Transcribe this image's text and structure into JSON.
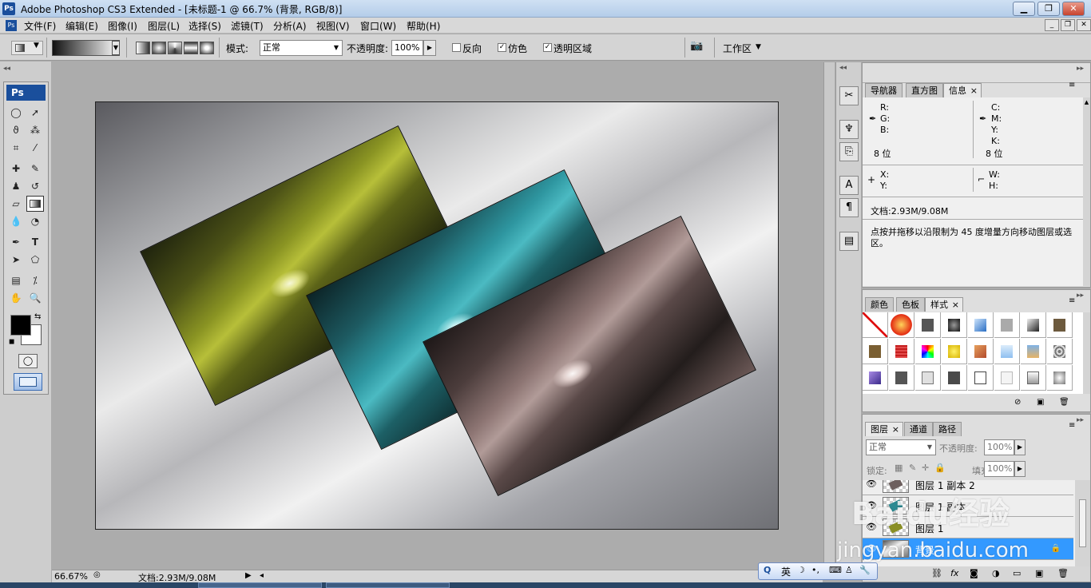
{
  "window": {
    "title": "Adobe Photoshop CS3 Extended - [未标题-1 @ 66.7% (背景, RGB/8)]",
    "logo": "Ps"
  },
  "menu": [
    "文件(F)",
    "编辑(E)",
    "图像(I)",
    "图层(L)",
    "选择(S)",
    "滤镜(T)",
    "分析(A)",
    "视图(V)",
    "窗口(W)",
    "帮助(H)"
  ],
  "options": {
    "mode_label": "模式:",
    "mode_value": "正常",
    "opacity_label": "不透明度:",
    "opacity_value": "100%",
    "reverse_label": "反向",
    "dither_label": "仿色",
    "transparency_label": "透明区域",
    "workspace_label": "工作区"
  },
  "toolbox": {
    "logo": "Ps"
  },
  "status": {
    "zoom": "66.67%",
    "doc": "文档:2.93M/9.08M"
  },
  "info_panel": {
    "tabs": [
      "导航器",
      "直方图",
      "信息"
    ],
    "rgb": [
      "R:",
      "G:",
      "B:"
    ],
    "cmyk": [
      "C:",
      "M:",
      "Y:",
      "K:"
    ],
    "bits_left": "8 位",
    "bits_right": "8 位",
    "xy": [
      "X:",
      "Y:"
    ],
    "wh": [
      "W:",
      "H:"
    ],
    "doc": "文档:2.93M/9.08M",
    "hint": "点按并拖移以沿限制为 45 度增量方向移动图层或选区。"
  },
  "styles_panel": {
    "tabs": [
      "颜色",
      "色板",
      "样式"
    ]
  },
  "layers_panel": {
    "tabs": [
      "图层",
      "通道",
      "路径"
    ],
    "blend": "正常",
    "opacity_label": "不透明度:",
    "opacity_value": "100%",
    "lock_label": "锁定:",
    "fill_label": "填充:",
    "fill_value": "100%",
    "layers": [
      "图层 1 副本 2",
      "图层 1 副本",
      "图层 1",
      "背景"
    ]
  },
  "watermark": {
    "brand": "Baidu经验",
    "url": "jingyan.baidu.com"
  },
  "ime": {
    "lang": "英"
  },
  "colors": {
    "accent": "#3399ff",
    "title_bar": "#c4d8f0",
    "photo_yellow": "#9aa028",
    "photo_cyan": "#2a8c95",
    "photo_mauve": "#8c7574"
  }
}
